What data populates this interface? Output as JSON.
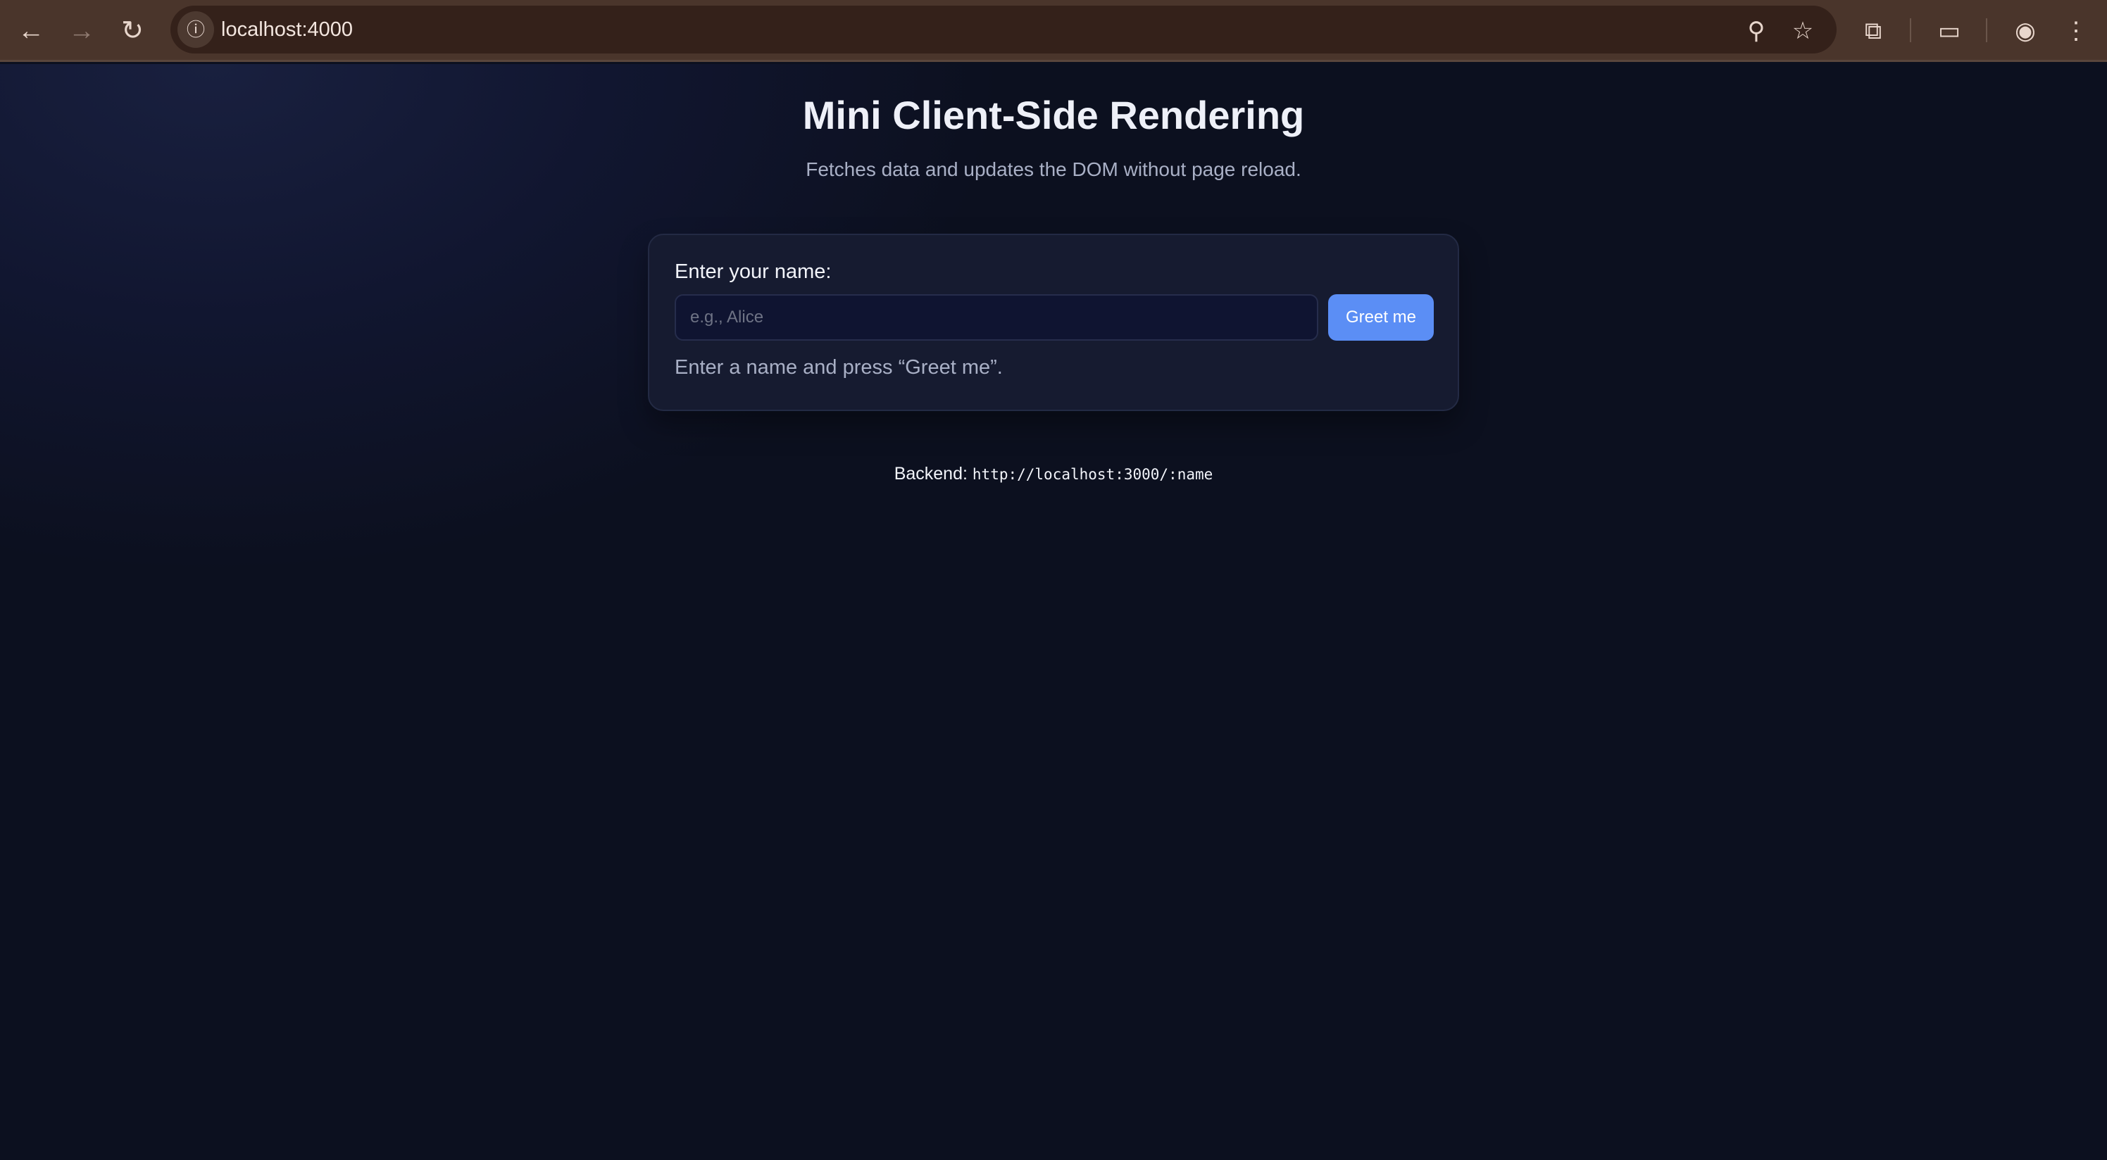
{
  "browser": {
    "url": "localhost:4000"
  },
  "page": {
    "title": "Mini Client-Side Rendering",
    "subtitle": "Fetches data and updates the DOM without page reload.",
    "form": {
      "label": "Enter your name:",
      "placeholder": "e.g., Alice",
      "value": "",
      "button": "Greet me",
      "status": "Enter a name and press “Greet me”."
    },
    "backend": {
      "label": "Backend:",
      "url": "http://localhost:3000/:name"
    }
  },
  "colors": {
    "accent": "#5b8ef5",
    "background": "#0c101f",
    "card": "#161b30"
  }
}
